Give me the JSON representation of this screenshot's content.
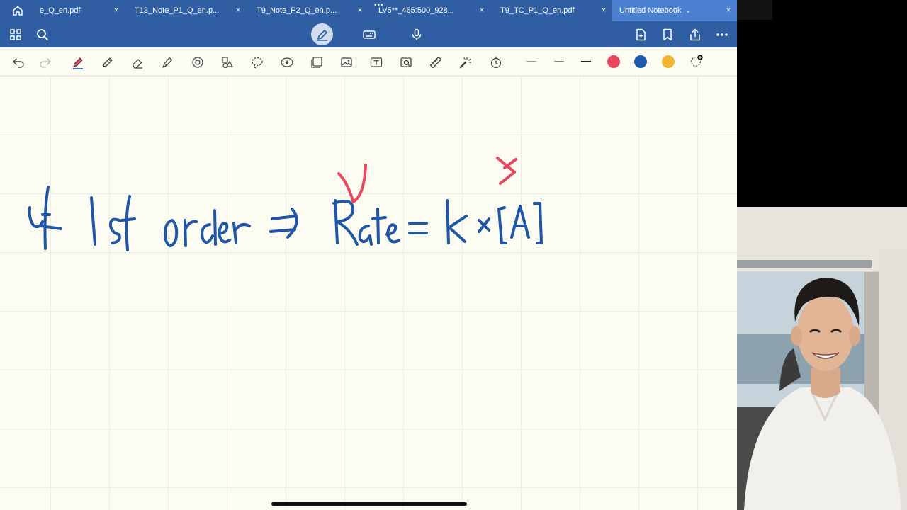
{
  "tabs": [
    {
      "label": "e_Q_en.pdf",
      "close": "×"
    },
    {
      "label": "T13_Note_P1_Q_en.p...",
      "close": "×"
    },
    {
      "label": "T9_Note_P2_Q_en.p...",
      "close": "×"
    },
    {
      "label": "LV5**_465:500_928...",
      "close": "×"
    },
    {
      "label": "T9_TC_P1_Q_en.pdf",
      "close": "×"
    },
    {
      "label": "Untitled Notebook",
      "close": "×",
      "chevron": "⌄"
    }
  ],
  "tab_dots": "•••",
  "icons": {
    "home": "home-icon",
    "grid": "grid-icon",
    "search": "search-icon",
    "pen_mode": "pencil-icon",
    "keyboard": "keyboard-icon",
    "mic": "microphone-icon",
    "add_page": "add-page-icon",
    "bookmark": "bookmark-icon",
    "share": "share-icon",
    "more": "more-icon"
  },
  "tools": [
    "undo",
    "redo",
    "pen",
    "pencil",
    "eraser",
    "highlighter",
    "shapes",
    "elements",
    "lasso",
    "stickers",
    "screenshot",
    "image",
    "text",
    "scan",
    "ruler",
    "laser-pointer",
    "timer"
  ],
  "colors": {
    "tabbar": "#2f5ea3",
    "active_tab": "#4a80cf",
    "ink_blue": "#1f56a6",
    "ink_red": "#e8485f",
    "swatches": [
      "#e8485f",
      "#1f5db0",
      "#f2b530"
    ]
  }
}
